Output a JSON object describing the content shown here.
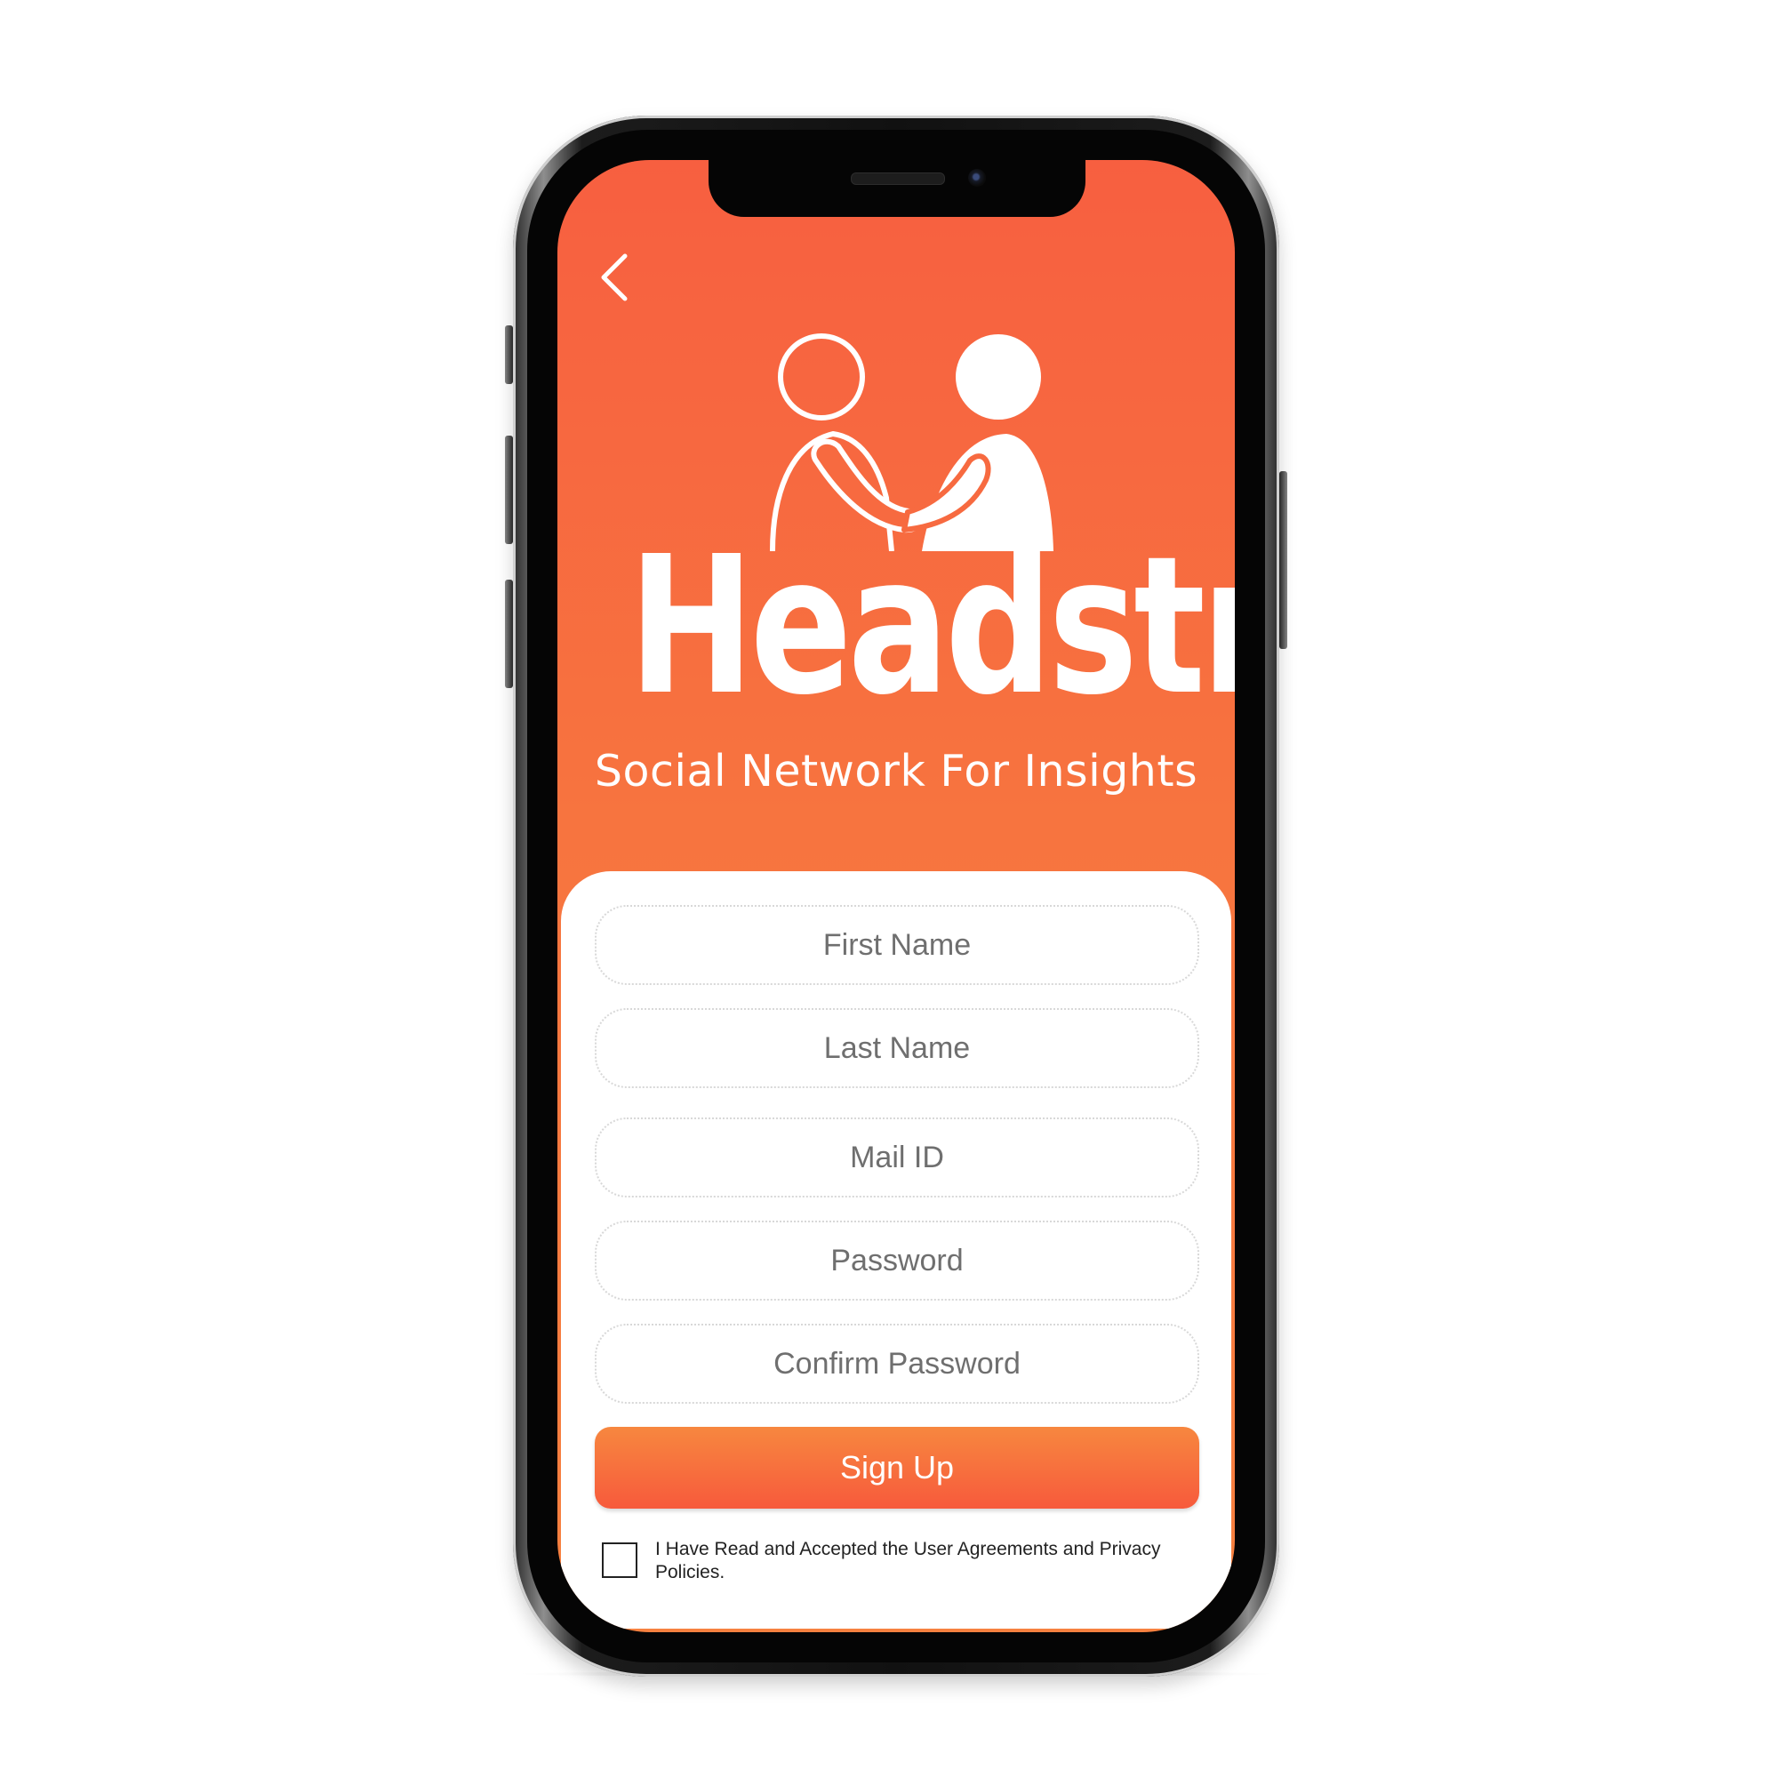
{
  "app": {
    "brand_name": "Headstrt",
    "tagline": "Social Network For Insights",
    "primary_color": "#F7673F",
    "accent_gradient": [
      "#F7873F",
      "#F75A3C"
    ]
  },
  "icons": {
    "back": "chevron-left-icon",
    "logo": "handshake-people-icon"
  },
  "form": {
    "first_name_placeholder": "First Name",
    "last_name_placeholder": "Last Name",
    "mail_placeholder": "Mail ID",
    "password_placeholder": "Password",
    "confirm_password_placeholder": "Confirm Password",
    "signup_label": "Sign Up",
    "agreement_text": "I Have Read and Accepted the User Agreements and Privacy Policies.",
    "agreement_checked": false
  }
}
